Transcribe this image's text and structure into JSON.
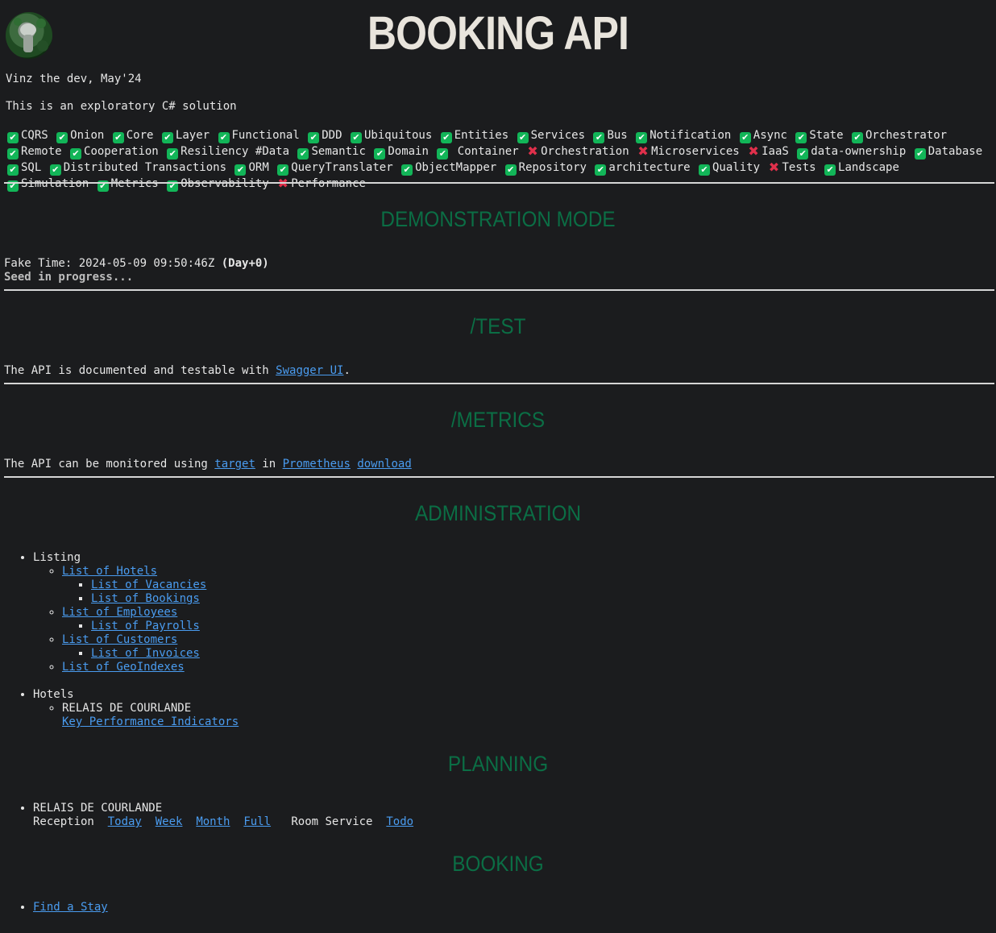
{
  "header": {
    "title": "BOOKING API",
    "author": "Vinz the dev, May'24",
    "description": "This is an exploratory C# solution"
  },
  "tags": [
    {
      "label": "CQRS",
      "status": "check"
    },
    {
      "label": "Onion",
      "status": "check"
    },
    {
      "label": "Core",
      "status": "check"
    },
    {
      "label": "Layer",
      "status": "check"
    },
    {
      "label": "Functional",
      "status": "check"
    },
    {
      "label": "DDD",
      "status": "check"
    },
    {
      "label": "Ubiquitous",
      "status": "check"
    },
    {
      "label": "Entities",
      "status": "check"
    },
    {
      "label": "Services",
      "status": "check"
    },
    {
      "label": "Bus",
      "status": "check"
    },
    {
      "label": "Notification",
      "status": "check"
    },
    {
      "label": "Async",
      "status": "check"
    },
    {
      "label": "State",
      "status": "check"
    },
    {
      "label": "Orchestrator",
      "status": "check"
    },
    {
      "label": "Remote",
      "status": "check"
    },
    {
      "label": "Cooperation",
      "status": "check"
    },
    {
      "label": "Resiliency #Data",
      "status": "check"
    },
    {
      "label": "Semantic",
      "status": "check"
    },
    {
      "label": "Domain",
      "status": "check"
    },
    {
      "label": " Container",
      "status": "check"
    },
    {
      "label": "Orchestration",
      "status": "cross"
    },
    {
      "label": "Microservices",
      "status": "cross"
    },
    {
      "label": "IaaS",
      "status": "cross"
    },
    {
      "label": "data-ownership",
      "status": "check"
    },
    {
      "label": "Database",
      "status": "check"
    },
    {
      "label": "SQL",
      "status": "check"
    },
    {
      "label": "Distributed Transactions",
      "status": "check"
    },
    {
      "label": "ORM",
      "status": "check"
    },
    {
      "label": "QueryTranslater",
      "status": "check"
    },
    {
      "label": "ObjectMapper",
      "status": "check"
    },
    {
      "label": "Repository",
      "status": "check"
    },
    {
      "label": "architecture",
      "status": "check"
    },
    {
      "label": "Quality",
      "status": "check"
    },
    {
      "label": "Tests",
      "status": "cross"
    },
    {
      "label": "Landscape",
      "status": "check"
    },
    {
      "label": "Simulation",
      "status": "check"
    },
    {
      "label": "Metrics",
      "status": "check"
    },
    {
      "label": "Observability",
      "status": "check"
    },
    {
      "label": "Performance",
      "status": "cross"
    }
  ],
  "demo": {
    "heading": "DEMONSTRATION MODE",
    "fake_time_label": "Fake Time: 2024-05-09 09:50:46Z",
    "day_label": "(Day+0)",
    "seed_status": "Seed in progress..."
  },
  "test": {
    "heading": "/TEST",
    "text_before": "The API is documented and testable with ",
    "link": "Swagger UI",
    "text_after": "."
  },
  "metrics": {
    "heading": "/METRICS",
    "text_before": "The API can be monitored using ",
    "link_target": "target",
    "text_in": " in ",
    "link_prometheus": "Prometheus",
    "link_download": "download"
  },
  "admin": {
    "heading": "ADMINISTRATION",
    "listing_label": "Listing",
    "hotels_link": "List of Hotels",
    "vacancies_link": "List of Vacancies",
    "bookings_link": "List of Bookings",
    "employees_link": "List of Employees",
    "payrolls_link": "List of Payrolls",
    "customers_link": "List of Customers",
    "invoices_link": "List of Invoices",
    "geoindexes_link": "List of GeoIndexes",
    "hotels_label": "Hotels",
    "hotel_name": "RELAIS DE COURLANDE",
    "kpi_link": "Key Performance Indicators"
  },
  "planning": {
    "heading": "PLANNING",
    "hotel_name": "RELAIS DE COURLANDE",
    "reception_label": "Reception",
    "today": "Today",
    "week": "Week",
    "month": "Month",
    "full": "Full",
    "room_service_label": "Room Service",
    "todo": "Todo"
  },
  "booking": {
    "heading": "BOOKING",
    "find_stay": "Find a Stay"
  }
}
